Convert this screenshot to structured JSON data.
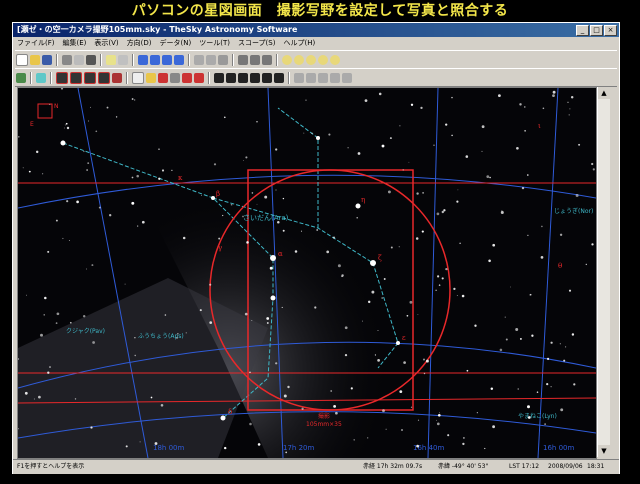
{
  "caption": "パソコンの星図画面　撮影写野を設定して写真と照合する",
  "window": {
    "title": "[瀬ゼ・の空一カメラ撮野105mm.sky - TheSky Astronomy Software",
    "buttons": [
      "_",
      "□",
      "×"
    ]
  },
  "menu": [
    "ファイル(F)",
    "編集(E)",
    "表示(V)",
    "方向(D)",
    "データ(N)",
    "ツール(T)",
    "スコープ(S)",
    "ヘルプ(H)"
  ],
  "chart": {
    "constellation_labels": [
      "さいだん(Ara)",
      "ふうちょう(Aps)",
      "やまねこ(Lyn)",
      "じょうぎ(Nor)",
      "クジャク(Pav)"
    ],
    "ra_labels": [
      "18h 00m",
      "17h 20m",
      "16h 40m",
      "16h 00m"
    ],
    "fov_label": [
      "撮影",
      "105mm×35"
    ],
    "compass": [
      "N",
      "E"
    ],
    "greek": [
      "β",
      "α",
      "γ",
      "ζ",
      "ε",
      "η",
      "δ",
      "θ",
      "ι",
      "κ"
    ]
  },
  "status": {
    "hint": "F1を押すとヘルプを表示",
    "ra": "赤経 17h 32m 09.7s",
    "dec": "赤緯 -49° 40' 53\"",
    "lst": "LST 17:12",
    "date": "2008/09/06",
    "time": "18:31"
  },
  "colors": {
    "caption": "#f3e64a",
    "fov_circle": "#e8282a",
    "fov_rect": "#e8282a",
    "constellation_lines": "#3fb8c8",
    "grid": "#2f5bd8",
    "ecliptic": "#e8282a",
    "labels": "#3fb8c8"
  }
}
